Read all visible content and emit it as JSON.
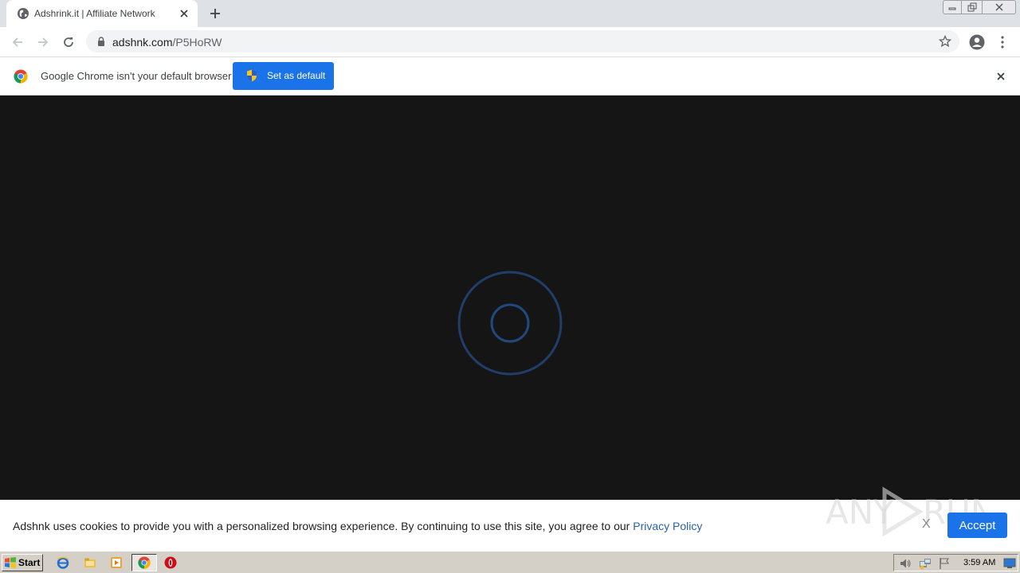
{
  "browser": {
    "tab": {
      "title": "Adshrink.it | Affiliate Network",
      "favicon": "globe-icon"
    },
    "toolbar": {
      "url_host": "adshnk.com",
      "url_path": "/P5HoRW"
    },
    "infobar": {
      "message": "Google Chrome isn't your default browser",
      "button_label": "Set as default"
    }
  },
  "cookie_bar": {
    "message": "Adshnk uses cookies to provide you with a personalized browsing experience. By continuing to use this site, you agree to our ",
    "link_label": "Privacy Policy",
    "dismiss_label": "X",
    "accept_label": "Accept"
  },
  "watermark": {
    "text": "ANY RUN"
  },
  "taskbar": {
    "start_label": "Start",
    "clock": "3:59 AM"
  },
  "colors": {
    "accent": "#1a73e8",
    "page_bg": "#151515",
    "loader": "#1f3f6a",
    "link": "#2b63a8"
  }
}
